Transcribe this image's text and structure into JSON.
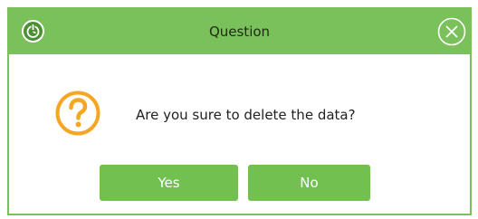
{
  "dialog": {
    "title": "Question",
    "message": "Are you sure to delete the data?",
    "buttons": {
      "yes_label": "Yes",
      "no_label": "No"
    }
  },
  "icons": {
    "app": "power-clock-icon",
    "close": "close-icon",
    "question": "question-mark-icon"
  },
  "colors": {
    "accent_green": "#7ac15c",
    "button_green": "#72c150",
    "question_orange": "#f5a623"
  }
}
